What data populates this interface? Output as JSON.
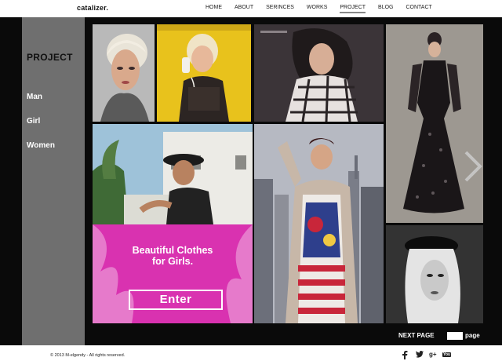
{
  "header": {
    "logo": "catalizer.",
    "nav": [
      "HOME",
      "ABOUT",
      "SERINCES",
      "WORKS",
      "PROJECT",
      "BLOG",
      "CONTACT"
    ],
    "active_nav": "PROJECT"
  },
  "sidebar": {
    "title": "PROJECT",
    "links": [
      "Man",
      "Girl",
      "Women"
    ]
  },
  "promo": {
    "title_line1": "Beautiful Clothes",
    "title_line2": "for Girls.",
    "button": "Enter"
  },
  "pagination": {
    "next_label": "NEXT PAGE",
    "page_label": "page"
  },
  "footer": {
    "copyright": "© 2013 M-elgendy - All rights reserved.",
    "social_icons": [
      "facebook-icon",
      "twitter-icon",
      "google-plus-icon",
      "youtube-icon"
    ],
    "google_plus_text": "g+",
    "youtube_text": "You"
  },
  "colors": {
    "promo_bg": "#d932b0",
    "sidebar_bg": "#6f6f6f",
    "main_bg": "#0a0a0a",
    "yellow_tile": "#e8c21c"
  }
}
